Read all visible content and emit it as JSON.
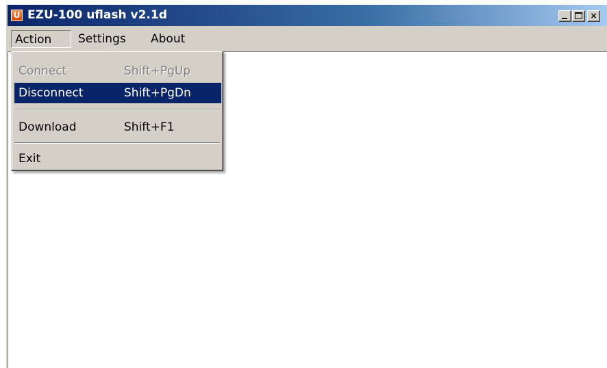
{
  "window": {
    "title": "EZU-100 uflash v2.1d",
    "icon_letter": "U",
    "minimize_icon": "minimize-icon",
    "maximize_icon": "maximize-icon",
    "close_icon": "close-icon",
    "close_glyph": "×"
  },
  "menubar": {
    "items": [
      {
        "label": "Action",
        "open": true
      },
      {
        "label": "Settings"
      },
      {
        "label": "About"
      }
    ]
  },
  "action_menu": {
    "items": [
      {
        "label": "Connect",
        "shortcut": "Shift+PgUp",
        "enabled": false
      },
      {
        "label": "Disconnect",
        "shortcut": "Shift+PgDn",
        "highlighted": true
      },
      {
        "label": "Download",
        "shortcut": "Shift+F1"
      },
      {
        "label": "Exit",
        "shortcut": ""
      }
    ]
  },
  "colors": {
    "title_bar_start": "#0a246a",
    "title_bar_end": "#a6caf0",
    "menu_highlight": "#0a246a",
    "face": "#d4d0c8",
    "disabled_text": "#808080"
  }
}
